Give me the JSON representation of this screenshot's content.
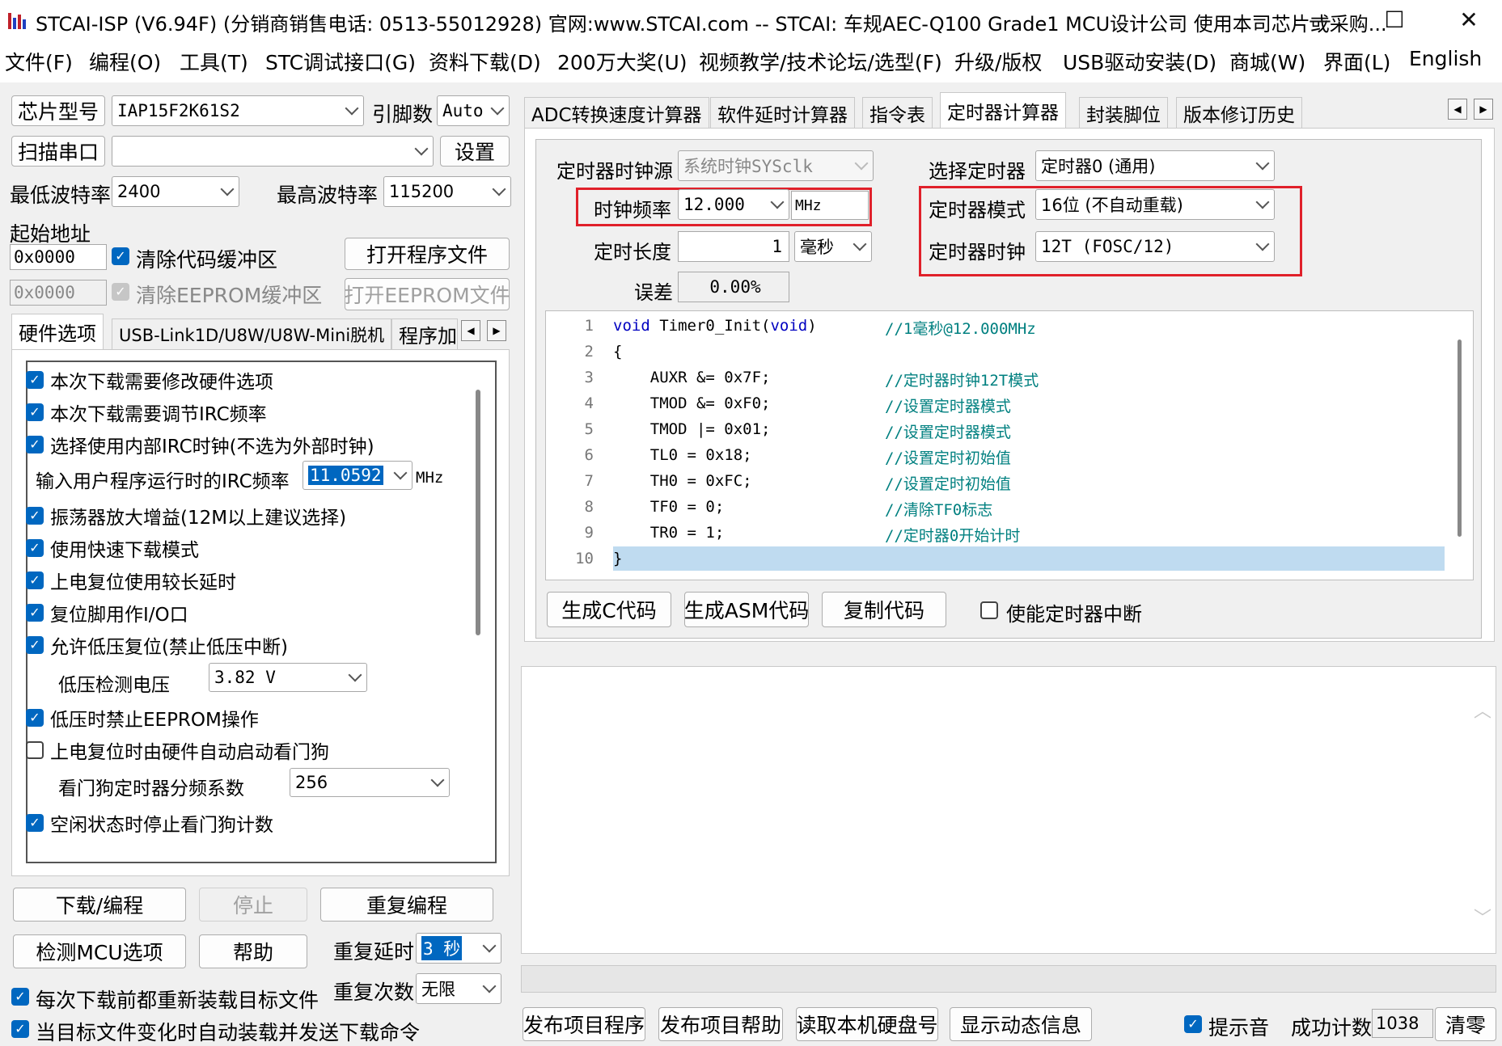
{
  "window": {
    "title": "STCAI-ISP (V6.94F) (分销商销售电话: 0513-55012928) 官网:www.STCAI.com  -- STCAI: 车规AEC-Q100 Grade1 MCU设计公司 使用本司芯片或采购...",
    "minimize": "—",
    "maximize": "☐",
    "close": "✕"
  },
  "menu": [
    "文件(F)",
    "编程(O)",
    "工具(T)",
    "STC调试接口(G)",
    "资料下载(D)",
    "200万大奖(U)",
    "视频教学/技术论坛/选型(F)",
    "升级/版权",
    "USB驱动安装(D)",
    "商城(W)",
    "界面(L)",
    "English"
  ],
  "left": {
    "chip_model_btn": "芯片型号",
    "chip_model_value": "IAP15F2K61S2",
    "pin_count_label": "引脚数",
    "pin_count_value": "Auto",
    "scan_port_btn": "扫描串口",
    "port_value": "",
    "settings_btn": "设置",
    "min_baud_label": "最低波特率",
    "min_baud_value": "2400",
    "max_baud_label": "最高波特率",
    "max_baud_value": "115200",
    "start_addr_label": "起始地址",
    "start_addr_value": "0x0000",
    "clear_code_label": "清除代码缓冲区",
    "open_program_btn": "打开程序文件",
    "eeprom_addr_value": "0x0000",
    "clear_eeprom_label": "清除EEPROM缓冲区",
    "open_eeprom_btn": "打开EEPROM文件",
    "tabs": [
      "硬件选项",
      "USB-Link1D/U8W/U8W-Mini脱机",
      "程序加"
    ],
    "options": {
      "o1": "本次下载需要修改硬件选项",
      "o2": "本次下载需要调节IRC频率",
      "o3": "选择使用内部IRC时钟(不选为外部时钟)",
      "irc_label": "输入用户程序运行时的IRC频率",
      "irc_value": "11.0592",
      "irc_unit": "MHz",
      "o4": "振荡器放大增益(12M以上建议选择)",
      "o5": "使用快速下载模式",
      "o6": "上电复位使用较长延时",
      "o7": "复位脚用作I/O口",
      "o8": "允许低压复位(禁止低压中断)",
      "lv_label": "低压检测电压",
      "lv_value": "3.82 V",
      "o9": "低压时禁止EEPROM操作",
      "o10": "上电复位时由硬件自动启动看门狗",
      "wdt_label": "看门狗定时器分频系数",
      "wdt_value": "256",
      "o11": "空闲状态时停止看门狗计数"
    },
    "download_btn": "下载/编程",
    "stop_btn": "停止",
    "reprogram_btn": "重复编程",
    "detect_btn": "检测MCU选项",
    "help_btn": "帮助",
    "repeat_delay_label": "重复延时",
    "repeat_delay_value": "3 秒",
    "repeat_count_label": "重复次数",
    "repeat_count_value": "无限",
    "reload_label": "每次下载前都重新装载目标文件",
    "auto_reload_label": "当目标文件变化时自动装载并发送下载命令"
  },
  "right": {
    "tabs": [
      "ADC转换速度计算器",
      "软件延时计算器",
      "指令表",
      "定时器计算器",
      "封装脚位",
      "版本修订历史"
    ],
    "timer": {
      "clock_source_label": "定时器时钟源",
      "clock_source_value": "系统时钟SYSclk",
      "select_timer_label": "选择定时器",
      "select_timer_value": "定时器0 (通用)",
      "freq_label": "时钟频率",
      "freq_value": "12.000",
      "freq_unit": "MHz",
      "mode_label": "定时器模式",
      "mode_value": "16位 (不自动重载)",
      "length_label": "定时长度",
      "length_value": "1",
      "length_unit": "毫秒",
      "clock_label": "定时器时钟",
      "clock_value": "12T (FOSC/12)",
      "error_label": "误差",
      "error_value": "0.00%"
    },
    "code": {
      "line_numbers": [
        "1",
        "2",
        "3",
        "4",
        "5",
        "6",
        "7",
        "8",
        "9",
        "10"
      ],
      "l1_a": "void",
      "l1_b": " Timer0_Init(",
      "l1_c": "void",
      "l1_d": ")",
      "l1_cm": "//1毫秒@12.000MHz",
      "l2": "{",
      "l3": "    AUXR &= 0x7F;",
      "l3_cm": "//定时器时钟12T模式",
      "l4": "    TMOD &= 0xF0;",
      "l4_cm": "//设置定时器模式",
      "l5": "    TMOD |= 0x01;",
      "l5_cm": "//设置定时器模式",
      "l6": "    TL0 = 0x18;",
      "l6_cm": "//设置定时初始值",
      "l7": "    TH0 = 0xFC;",
      "l7_cm": "//设置定时初始值",
      "l8": "    TF0 = 0;",
      "l8_cm": "//清除TF0标志",
      "l9": "    TR0 = 1;",
      "l9_cm": "//定时器0开始计时",
      "l10": "}"
    },
    "gen_c_btn": "生成C代码",
    "gen_asm_btn": "生成ASM代码",
    "copy_btn": "复制代码",
    "enable_int_label": "使能定时器中断",
    "publish_program_btn": "发布项目程序",
    "publish_help_btn": "发布项目帮助",
    "read_disk_btn": "读取本机硬盘号",
    "show_dynamic_btn": "显示动态信息",
    "sound_label": "提示音",
    "success_count_label": "成功计数",
    "success_count_value": "1038",
    "clear_btn": "清零"
  }
}
